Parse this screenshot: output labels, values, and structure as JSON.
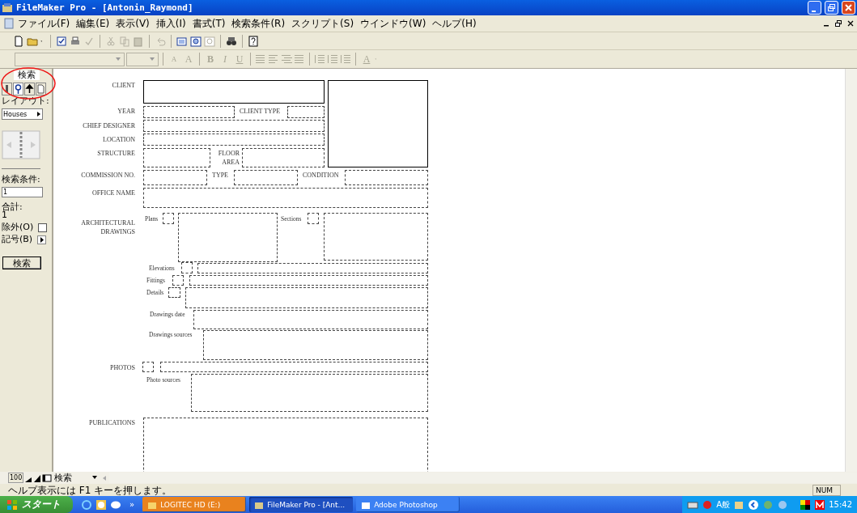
{
  "window": {
    "title": "FileMaker Pro - [Antonin_Raymond]"
  },
  "menu": [
    "ファイル(F)",
    "編集(E)",
    "表示(V)",
    "挿入(I)",
    "書式(T)",
    "検索条件(R)",
    "スクリプト(S)",
    "ウインドウ(W)",
    "ヘルプ(H)"
  ],
  "format_toolbar": [
    {
      "label": "A",
      "kind": "size-down",
      "disabled": true
    },
    {
      "label": "A",
      "kind": "size-up",
      "disabled": true
    },
    {
      "label": "B",
      "kind": "bold",
      "disabled": true
    },
    {
      "label": "I",
      "kind": "italic",
      "disabled": true
    },
    {
      "label": "U",
      "kind": "underline",
      "disabled": true
    },
    {
      "label": "A",
      "kind": "text-color",
      "disabled": true
    }
  ],
  "status_area": {
    "mode_tab": "検索",
    "layout_label": "レイアウト:",
    "layout_popup": "Houses",
    "requests_label": "検索条件:",
    "request_value": "1",
    "total_label": "合計:",
    "total_value": "1",
    "omit_label": "除外(O)",
    "omit_checked": false,
    "symbols_label": "記号(B)",
    "find_button": "検索"
  },
  "form_labels": [
    "CLIENT",
    "YEAR",
    "CLIENT TYPE",
    "CHIEF DESIGNER",
    "LOCATION",
    "STRUCTURE",
    "FLOOR AREA",
    "COMMISSION NO.",
    "TYPE",
    "CONDITION",
    "OFFICE NAME",
    "ARCHITECTURAL DRAWINGS",
    "Plans",
    "Sections",
    "Elevations",
    "Fittings",
    "Details",
    "Drawings date",
    "Drawings sources",
    "PHOTOS",
    "Photo sources",
    "PUBLICATIONS"
  ],
  "bottom_bar": {
    "zoom": "100",
    "mode": "検索"
  },
  "status_bar": {
    "help": "ヘルプ表示には F1 キーを押します。",
    "indicator": "NUM"
  },
  "taskbar": {
    "start": "スタート",
    "chevron": "»",
    "tasks": [
      {
        "label": "LOGITEC HD (E:)",
        "selected": false,
        "attention": true
      },
      {
        "label": "FileMaker Pro - [Ant...",
        "selected": true,
        "attention": false
      },
      {
        "label": "Adobe Photoshop",
        "selected": false,
        "attention": false
      }
    ],
    "ime": "A般",
    "clock": "15:42"
  }
}
